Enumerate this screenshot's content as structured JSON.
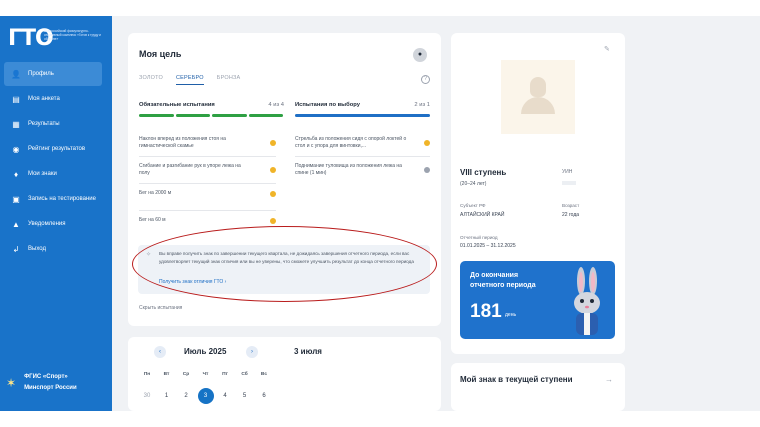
{
  "brand": {
    "logo": "ГТО",
    "tagline": "Всероссийский физкультурно-спортивный комплекс «Готов к труду и обороне»"
  },
  "sidebar": {
    "items": [
      {
        "label": "Профиль",
        "icon": "person-icon",
        "glyph": "👤",
        "active": true
      },
      {
        "label": "Моя анкета",
        "icon": "document-icon",
        "glyph": "▤",
        "active": false
      },
      {
        "label": "Результаты",
        "icon": "table-icon",
        "glyph": "▦",
        "active": false
      },
      {
        "label": "Рейтинг результатов",
        "icon": "rating-icon",
        "glyph": "◉",
        "active": false
      },
      {
        "label": "Мои знаки",
        "icon": "badge-icon",
        "glyph": "♦",
        "active": false
      },
      {
        "label": "Запись на тестирование",
        "icon": "calendar-icon",
        "glyph": "▣",
        "active": false
      },
      {
        "label": "Уведомления",
        "icon": "bell-icon",
        "glyph": "▲",
        "active": false
      },
      {
        "label": "Выход",
        "icon": "logout-icon",
        "glyph": "↲",
        "active": false
      }
    ],
    "footer": {
      "line1": "ФГИС «Спорт»",
      "line2": "Минспорт России"
    }
  },
  "goal": {
    "title": "Моя цель",
    "tabs": [
      "ЗОЛОТО",
      "СЕРЕБРО",
      "БРОНЗА"
    ],
    "active_tab": 1,
    "mandatory": {
      "title": "Обязательные испытания",
      "count": "4 из 4"
    },
    "optional": {
      "title": "Испытания по выбору",
      "count": "2 из 1"
    },
    "mandatory_items": [
      {
        "text": "Наклон вперед из положения стоя на гимнастической скамье",
        "status": "#f0b429"
      },
      {
        "text": "Сгибание и разгибание рук в упоре лежа на полу",
        "status": "#f0b429"
      },
      {
        "text": "Бег на 2000 м",
        "status": "#f0b429"
      },
      {
        "text": "Бег на 60 м",
        "status": "#f0b429"
      }
    ],
    "optional_items": [
      {
        "text": "Стрельба из положения сидя с опорой локтей о стол и с упора для винтовки,...",
        "status": "#f0b429"
      },
      {
        "text": "Поднимание туловища из положения лежа на спине (1 мин)",
        "status": "#9ca3af"
      }
    ],
    "info_text": "Вы вправе получить знак по завершении текущего квартала, не дожидаясь завершения отчетного периода, если вас удовлетворяет текущий знак отличия или вы не уверены, что сможете улучшить результат до конца отчетного периода",
    "info_link": "Получить знак отличия ГТО",
    "hide_link": "Скрыть испытания",
    "colors": {
      "accent": "#1f5fa8",
      "bar_done": "#2ea043",
      "bar_progress": "#1f6fc5"
    }
  },
  "calendar": {
    "month": "Июль 2025",
    "selected": "3 июля",
    "weekdays": [
      "Пн",
      "Вт",
      "Ср",
      "Чт",
      "Пт",
      "Сб",
      "Вс"
    ],
    "days": [
      {
        "d": "30",
        "muted": true
      },
      {
        "d": "1",
        "muted": false
      },
      {
        "d": "2",
        "muted": false
      },
      {
        "d": "3",
        "today": true
      },
      {
        "d": "4",
        "muted": false
      },
      {
        "d": "5",
        "muted": false
      },
      {
        "d": "6",
        "muted": false
      }
    ]
  },
  "profile": {
    "stage": "VIII ступень",
    "age_range": "(20–24 лет)",
    "uin_label": "УИН",
    "region_label": "Субъект РФ",
    "region": "АЛТАЙСКИЙ КРАЙ",
    "age_label": "Возраст",
    "age": "22 года",
    "period_label": "Отчетный период",
    "period": "01.01.2025 – 31.12.2025",
    "promo_title": "До окончания отчетного периода",
    "promo_days": "181",
    "promo_unit": "день"
  },
  "my_badge": {
    "title": "Мой знак в текущей ступени"
  }
}
